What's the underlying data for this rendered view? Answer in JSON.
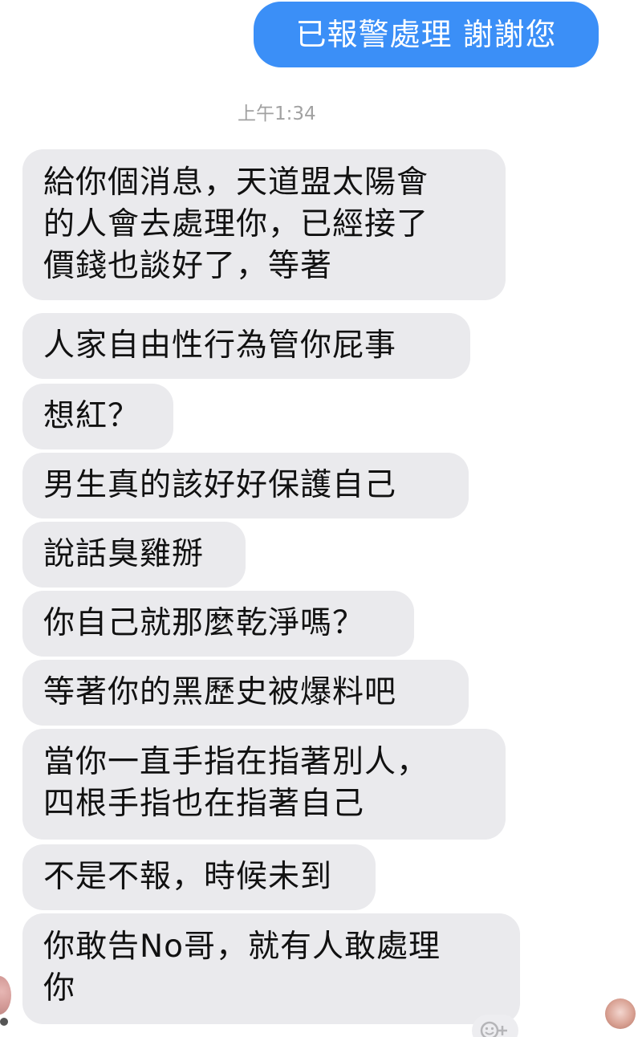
{
  "sent_message": {
    "text": "已報警處理 謝謝您"
  },
  "timestamp": "上午1:34",
  "received_messages": [
    {
      "lines": [
        "給你個消息，天道盟太陽會",
        "的人會去處理你，已經接了",
        "價錢也談好了，等著"
      ]
    },
    {
      "lines": [
        "人家自由性行為管你屁事"
      ]
    },
    {
      "lines": [
        "想紅？"
      ]
    },
    {
      "lines": [
        "男生真的該好好保護自己"
      ]
    },
    {
      "lines": [
        "說話臭雞掰"
      ]
    },
    {
      "lines": [
        "你自己就那麼乾淨嗎？"
      ]
    },
    {
      "lines": [
        "等著你的黑歷史被爆料吧"
      ]
    },
    {
      "lines": [
        "當你一直手指在指著別人，",
        "四根手指也在指著自己"
      ]
    },
    {
      "lines": [
        "不是不報，時候未到"
      ]
    },
    {
      "lines": [
        "你敢告No哥，就有人敢處理",
        "你"
      ]
    }
  ],
  "reaction_add_icon": "emoji-add-icon",
  "colors": {
    "sent_bubble": "#3b8ff7",
    "received_bubble": "#eaeaed",
    "timestamp": "#a1a1a1"
  }
}
